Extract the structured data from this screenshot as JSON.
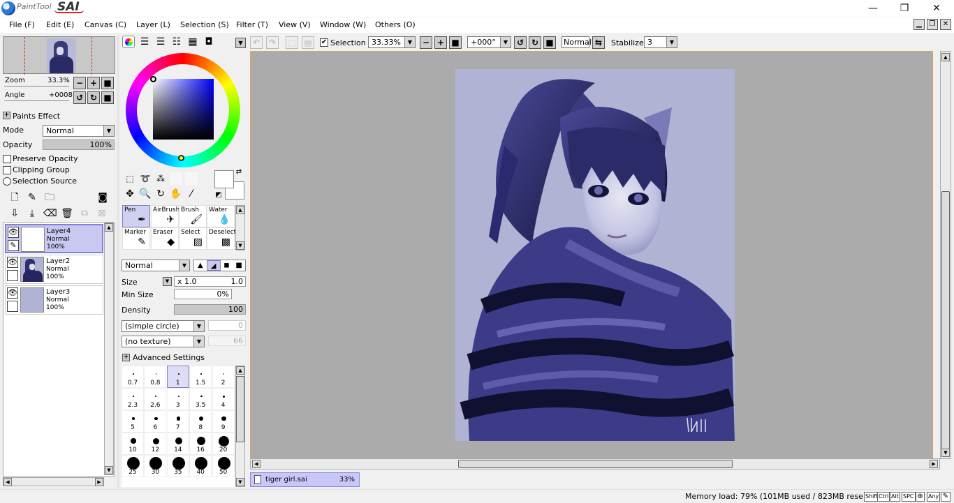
{
  "app": {
    "logo_small": "PaintTool",
    "logo_big": "SAI",
    "window_controls": {
      "minimize": "—",
      "restore": "❐",
      "close": "✕"
    }
  },
  "menu": [
    {
      "label": "File (F)"
    },
    {
      "label": "Edit (E)"
    },
    {
      "label": "Canvas (C)"
    },
    {
      "label": "Layer (L)"
    },
    {
      "label": "Selection (S)"
    },
    {
      "label": "Filter (T)"
    },
    {
      "label": "View (V)"
    },
    {
      "label": "Window (W)"
    },
    {
      "label": "Others (O)"
    }
  ],
  "navigator": {
    "zoom_label": "Zoom",
    "zoom_value": "33.3%",
    "angle_label": "Angle",
    "angle_value": "+0008"
  },
  "layer_panel": {
    "paints_effect": "Paints Effect",
    "mode_label": "Mode",
    "mode_value": "Normal",
    "opacity_label": "Opacity",
    "opacity_value": "100%",
    "preserve_opacity": "Preserve Opacity",
    "clipping_group": "Clipping Group",
    "selection_source": "Selection Source",
    "layers": [
      {
        "name": "Layer4",
        "mode": "Normal",
        "opacity": "100%"
      },
      {
        "name": "Layer2",
        "mode": "Normal",
        "opacity": "100%"
      },
      {
        "name": "Layer3",
        "mode": "Normal",
        "opacity": "100%"
      }
    ]
  },
  "tools": {
    "grid": [
      {
        "label": "Pen",
        "icon": "✒"
      },
      {
        "label": "AirBrush",
        "icon": "✈"
      },
      {
        "label": "Brush",
        "icon": "🖌"
      },
      {
        "label": "Water",
        "icon": "💧"
      },
      {
        "label": "Marker",
        "icon": "✎"
      },
      {
        "label": "Eraser",
        "icon": "◆"
      },
      {
        "label": "Select",
        "icon": "▨"
      },
      {
        "label": "Deselect",
        "icon": "▩"
      }
    ],
    "blend_mode": "Normal",
    "size_label": "Size",
    "size_mult": "x 1.0",
    "size_value": "1.0",
    "min_size_label": "Min Size",
    "min_size_value": "0%",
    "density_label": "Density",
    "density_value": "100",
    "shape": "(simple circle)",
    "shape_value": "0",
    "texture": "(no texture)",
    "texture_value": "66",
    "advanced": "Advanced Settings",
    "brush_sizes": [
      "0.7",
      "0.8",
      "1",
      "1.5",
      "2",
      "2.3",
      "2.6",
      "3",
      "3.5",
      "4",
      "5",
      "6",
      "7",
      "8",
      "9",
      "10",
      "12",
      "14",
      "16",
      "20",
      "25",
      "30",
      "35",
      "40",
      "50"
    ]
  },
  "toolbar": {
    "selection_label": "Selection",
    "zoom": "33.33%",
    "rotation": "+000°",
    "blend": "Normal",
    "stabilizer_label": "Stabilizer",
    "stabilizer_value": "3"
  },
  "document": {
    "name": "tiger girl.sai",
    "zoom": "33%"
  },
  "status": {
    "memory": "Memory load: 79% (101MB used / 823MB reserved)",
    "keys": [
      "Shift",
      "Ctrl",
      "Alt",
      "SPC",
      "Any"
    ]
  },
  "colors": {
    "accent": "#c8c8f0",
    "canvas_bg": "#ababab",
    "art_bg": "#b1b3d4"
  }
}
